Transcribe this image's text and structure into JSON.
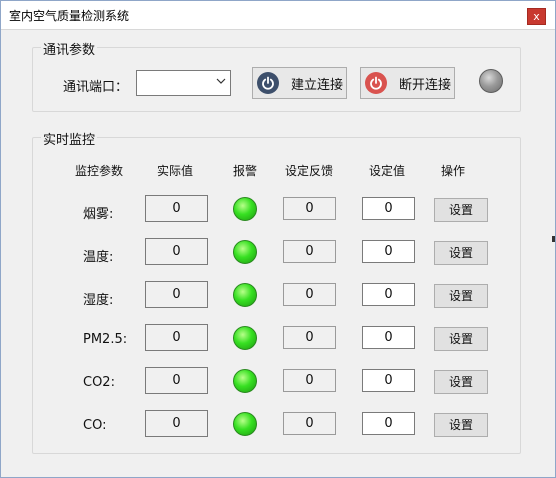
{
  "window": {
    "title": "室内空气质量检测系统",
    "close_label": "x"
  },
  "comm": {
    "group_title": "通讯参数",
    "port_label": "通讯端口：",
    "port_value": "",
    "connect_label": "建立连接",
    "disconnect_label": "断开连接",
    "connect_icon_color": "#3d4f6b",
    "disconnect_icon_color": "#d9534f"
  },
  "monitor": {
    "group_title": "实时监控",
    "headers": {
      "param": "监控参数",
      "actual": "实际值",
      "alarm": "报警",
      "feedback": "设定反馈",
      "setpoint": "设定值",
      "action": "操作"
    },
    "rows": [
      {
        "name": "烟雾:",
        "actual": "0",
        "feedback": "0",
        "setpoint": "0",
        "button": "设置"
      },
      {
        "name": "温度:",
        "actual": "0",
        "feedback": "0",
        "setpoint": "0",
        "button": "设置"
      },
      {
        "name": "湿度:",
        "actual": "0",
        "feedback": "0",
        "setpoint": "0",
        "button": "设置"
      },
      {
        "name": "PM2.5:",
        "actual": "0",
        "feedback": "0",
        "setpoint": "0",
        "button": "设置"
      },
      {
        "name": "CO2:",
        "actual": "0",
        "feedback": "0",
        "setpoint": "0",
        "button": "设置"
      },
      {
        "name": "CO:",
        "actual": "0",
        "feedback": "0",
        "setpoint": "0",
        "button": "设置"
      }
    ],
    "alarm_color": "#37e022"
  }
}
